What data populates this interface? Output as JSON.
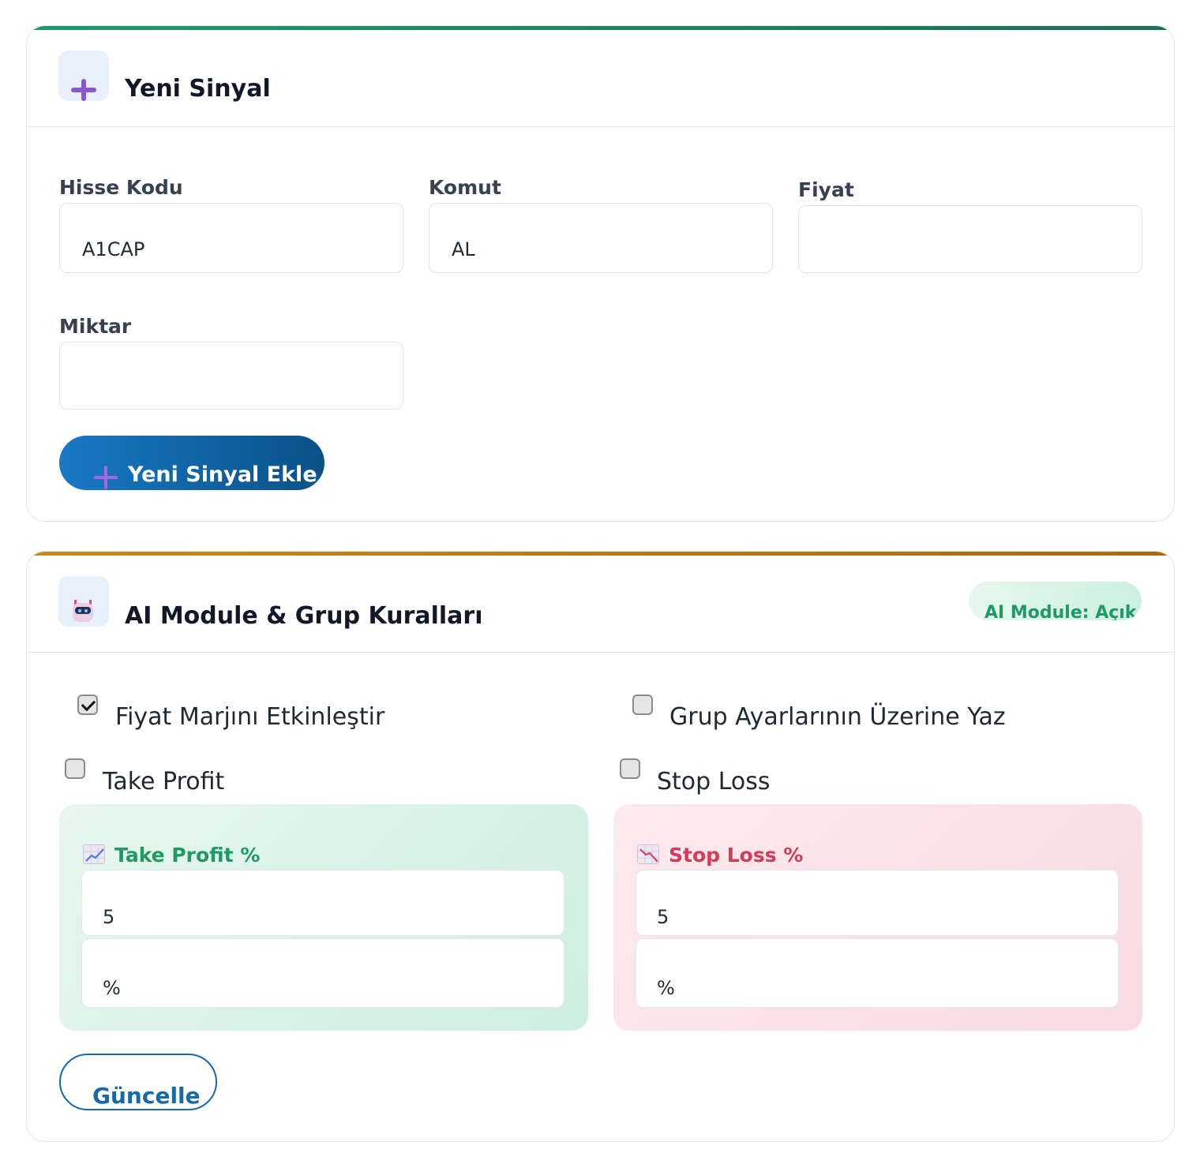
{
  "new_signal": {
    "title": "Yeni Sinyal",
    "icon": "plus-icon",
    "fields": {
      "stock_code": {
        "label": "Hisse Kodu",
        "value": "A1CAP"
      },
      "command": {
        "label": "Komut",
        "value": "AL"
      },
      "price": {
        "label": "Fiyat",
        "value": ""
      },
      "quantity": {
        "label": "Miktar",
        "value": ""
      }
    },
    "add_button": "Yeni Sinyal Ekle"
  },
  "ai_module": {
    "title": "AI Module & Grup Kuralları",
    "icon": "robot-icon",
    "status_badge": "AI Module: Açık",
    "options": {
      "price_margin": {
        "label": "Fiyat Marjını Etkinleştir",
        "checked": true
      },
      "override_group": {
        "label": "Grup Ayarlarının Üzerine Yaz",
        "checked": false
      },
      "take_profit": {
        "label": "Take Profit",
        "checked": false
      },
      "stop_loss": {
        "label": "Stop Loss",
        "checked": false
      }
    },
    "take_profit_panel": {
      "title": "Take Profit %",
      "icon": "chart-increasing-icon",
      "value": "5",
      "unit": "%"
    },
    "stop_loss_panel": {
      "title": "Stop Loss %",
      "icon": "chart-decreasing-icon",
      "value": "5",
      "unit": "%"
    },
    "update_button": "Güncelle"
  },
  "colors": {
    "primary": "#1769a8",
    "success": "#1e9a63",
    "danger": "#d23c57",
    "new_signal_accent": "#1f9a6a",
    "ai_accent": "#c98a1a"
  }
}
